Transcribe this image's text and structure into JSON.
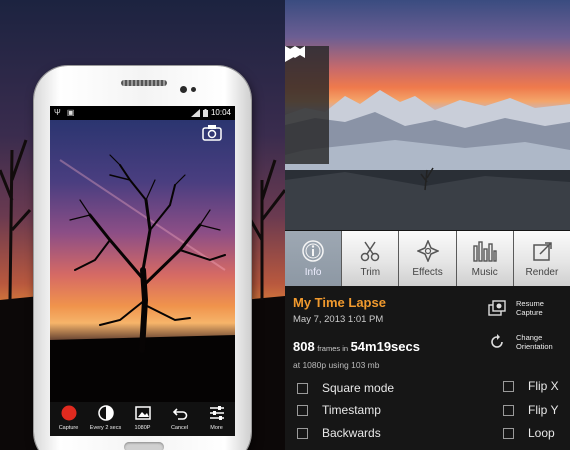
{
  "left_panel": {
    "phone": {
      "status_bar": {
        "left_icons": "Ψ ▣",
        "signal_icon": "signal-icon",
        "battery_icon": "battery-icon",
        "time": "10:04"
      },
      "switch_camera_icon": "camera-switch-icon",
      "bottom_bar": [
        {
          "label": "Capture",
          "icon": "record-icon"
        },
        {
          "label": "Every 2 secs",
          "icon": "interval-icon"
        },
        {
          "label": "1080P",
          "icon": "resolution-icon"
        },
        {
          "label": "Cancel",
          "icon": "undo-icon"
        },
        {
          "label": "More",
          "icon": "sliders-icon"
        }
      ]
    }
  },
  "right_panel": {
    "playback_controls": [
      {
        "icon": "rewind-icon"
      },
      {
        "icon": "play-icon"
      },
      {
        "icon": "fast-forward-icon"
      }
    ],
    "tabs": [
      {
        "label": "Info",
        "icon": "info-icon",
        "active": true
      },
      {
        "label": "Trim",
        "icon": "scissors-icon",
        "active": false
      },
      {
        "label": "Effects",
        "icon": "effects-icon",
        "active": false
      },
      {
        "label": "Music",
        "icon": "equalizer-icon",
        "active": false
      },
      {
        "label": "Render",
        "icon": "render-icon",
        "active": false
      }
    ],
    "info": {
      "title": "My Time Lapse",
      "date": "May 7, 2013 1:01 PM",
      "frames_count": "808",
      "frames_label": "frames in",
      "duration": "54m19secs",
      "meta": "at 1080p using 103 mb"
    },
    "actions": [
      {
        "label": "Resume Capture",
        "icon": "resume-capture-icon"
      },
      {
        "label": "Change Orientation",
        "icon": "rotate-icon"
      }
    ],
    "options_left": [
      {
        "label": "Square mode",
        "checked": false
      },
      {
        "label": "Timestamp",
        "checked": false
      },
      {
        "label": "Backwards",
        "checked": false
      }
    ],
    "options_right": [
      {
        "label": "Flip X",
        "checked": false
      },
      {
        "label": "Flip Y",
        "checked": false
      },
      {
        "label": "Loop",
        "checked": false
      }
    ]
  },
  "colors": {
    "accent_orange": "#f19a2e",
    "record_red": "#e02a1f",
    "tab_active": "#8d98a4"
  }
}
